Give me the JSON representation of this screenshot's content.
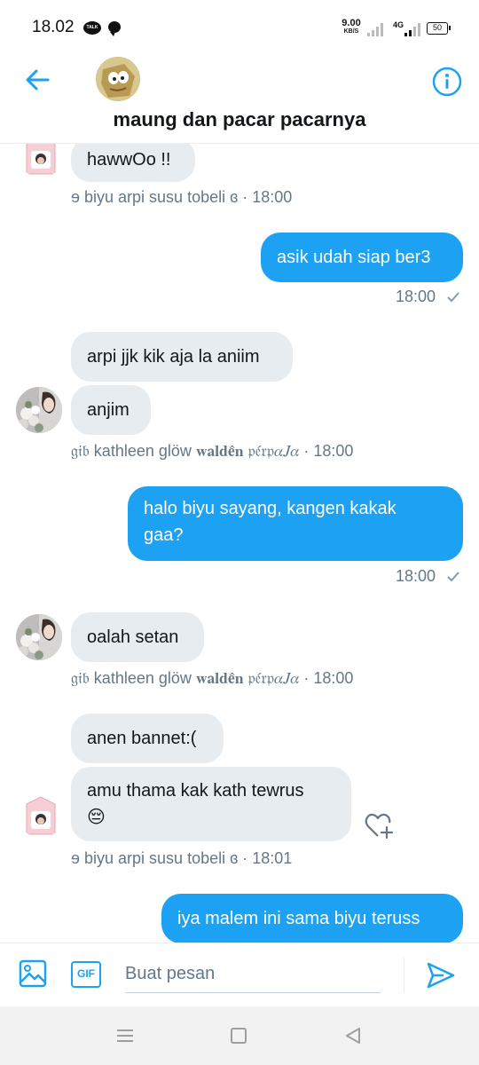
{
  "status_bar": {
    "time": "18.02",
    "talk_label": "TALK",
    "speed_value": "9.00",
    "speed_unit": "KB/S",
    "network": "4G",
    "battery": "50"
  },
  "header": {
    "title": "maung dan pacar pacarnya",
    "back_icon": "arrow-left-icon",
    "info_icon": "info-circle-icon"
  },
  "colors": {
    "accent": "#1da1f2",
    "incoming_bubble": "#e6ecf0",
    "meta_text": "#657786"
  },
  "messages": [
    {
      "direction": "in",
      "text": "hawwOo !!"
    },
    {
      "direction": "in",
      "sender_time": "ɘ biyu arpi susu tobeli ɞ · 18:00"
    },
    {
      "direction": "out",
      "text": "asik udah siap ber3",
      "time": "18:00"
    },
    {
      "direction": "in",
      "text": "arpi jjk kik aja la aniim"
    },
    {
      "direction": "in",
      "text": "anjim",
      "sender_time": "𝔤𝔦𝔟 kathleen glöw 𝐰𝐚𝐥𝐝𝐞̂𝐧 𝔭𝔢́𝔯𝔭𝛼𝐽𝛼 · 18:00"
    },
    {
      "direction": "out",
      "text_line1": "halo biyu sayang, kangen kakak",
      "text_line2": "gaa?",
      "time": "18:00"
    },
    {
      "direction": "in",
      "text": "oalah setan",
      "sender_time": "𝔤𝔦𝔟 kathleen glöw 𝐰𝐚𝐥𝐝𝐞̂𝐧 𝔭𝔢́𝔯𝔭𝛼𝐽𝛼 · 18:00"
    },
    {
      "direction": "in",
      "text": "anen bannet:("
    },
    {
      "direction": "in",
      "text_line1": "amu thama kak kath tewrus",
      "emoji": "😔",
      "sender_time": "ɘ biyu arpi susu tobeli ɞ · 18:01"
    },
    {
      "direction": "out",
      "text": "iya malem ini sama biyu teruss"
    }
  ],
  "composer": {
    "placeholder": "Buat pesan",
    "gif_label": "GIF",
    "image_icon": "image-icon",
    "send_icon": "send-icon"
  },
  "nav": {
    "menu_icon": "recent-apps-icon",
    "home_icon": "home-icon",
    "back_icon": "nav-back-icon"
  }
}
